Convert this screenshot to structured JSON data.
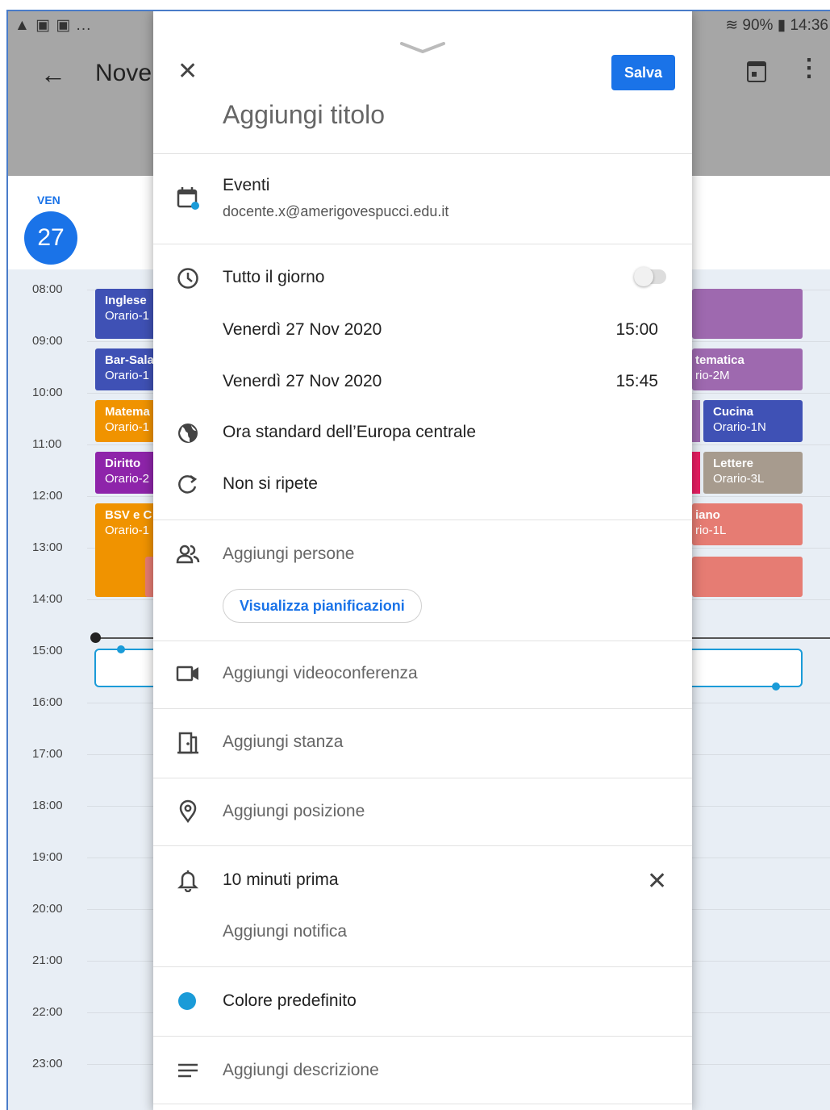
{
  "status_bar": {
    "left_icons": "▲ ▣ ▣ ...",
    "battery": "90%",
    "time": "14:36"
  },
  "calendar": {
    "month_title": "Nove",
    "day_name": "VEN",
    "day_number": "27",
    "hours": [
      "08:00",
      "09:00",
      "10:00",
      "11:00",
      "12:00",
      "13:00",
      "14:00",
      "15:00",
      "16:00",
      "17:00",
      "18:00",
      "19:00",
      "20:00",
      "21:00",
      "22:00",
      "23:00"
    ],
    "events_left": [
      {
        "title": "Inglese",
        "sub": "Orario-1",
        "color": "#3f51b5"
      },
      {
        "title": "Bar-Sala",
        "sub": "Orario-1",
        "color": "#3f51b5"
      },
      {
        "title": "Matema",
        "sub": "Orario-1",
        "color": "#f09300"
      },
      {
        "title": "Diritto",
        "sub": "Orario-2",
        "color": "#8e24aa"
      },
      {
        "title": "BSV e C",
        "sub": "Orario-1",
        "color": "#f09300"
      }
    ],
    "events_right": [
      {
        "title": "tematica",
        "sub": "rio-2M",
        "color": "#9e69af"
      },
      {
        "title": "Cucina",
        "sub": "Orario-1N",
        "color": "#3f51b5"
      },
      {
        "title": "Lettere",
        "sub": "Orario-3L",
        "color": "#a79b8e"
      },
      {
        "title": "iano",
        "sub": "rio-1L",
        "color": "#e67c73"
      }
    ]
  },
  "sheet": {
    "save_label": "Salva",
    "title_placeholder": "Aggiungi titolo",
    "calendar_name": "Eventi",
    "account": "docente.x@amerigovespucci.edu.it",
    "all_day_label": "Tutto il giorno",
    "start_date": "Venerdì 27 Nov 2020",
    "start_time": "15:00",
    "end_date": "Venerdì 27 Nov 2020",
    "end_time": "15:45",
    "timezone": "Ora standard dell’Europa centrale",
    "repeat": "Non si ripete",
    "add_people": "Aggiungi persone",
    "view_schedules": "Visualizza pianificazioni",
    "add_video": "Aggiungi videoconferenza",
    "add_room": "Aggiungi stanza",
    "add_location": "Aggiungi posizione",
    "notification": "10 minuti prima",
    "add_notification": "Aggiungi notifica",
    "color": "Colore predefinito",
    "add_description": "Aggiungi descrizione"
  },
  "colors": {
    "accent": "#1a73e8",
    "event_dot": "#1a9bd8"
  }
}
